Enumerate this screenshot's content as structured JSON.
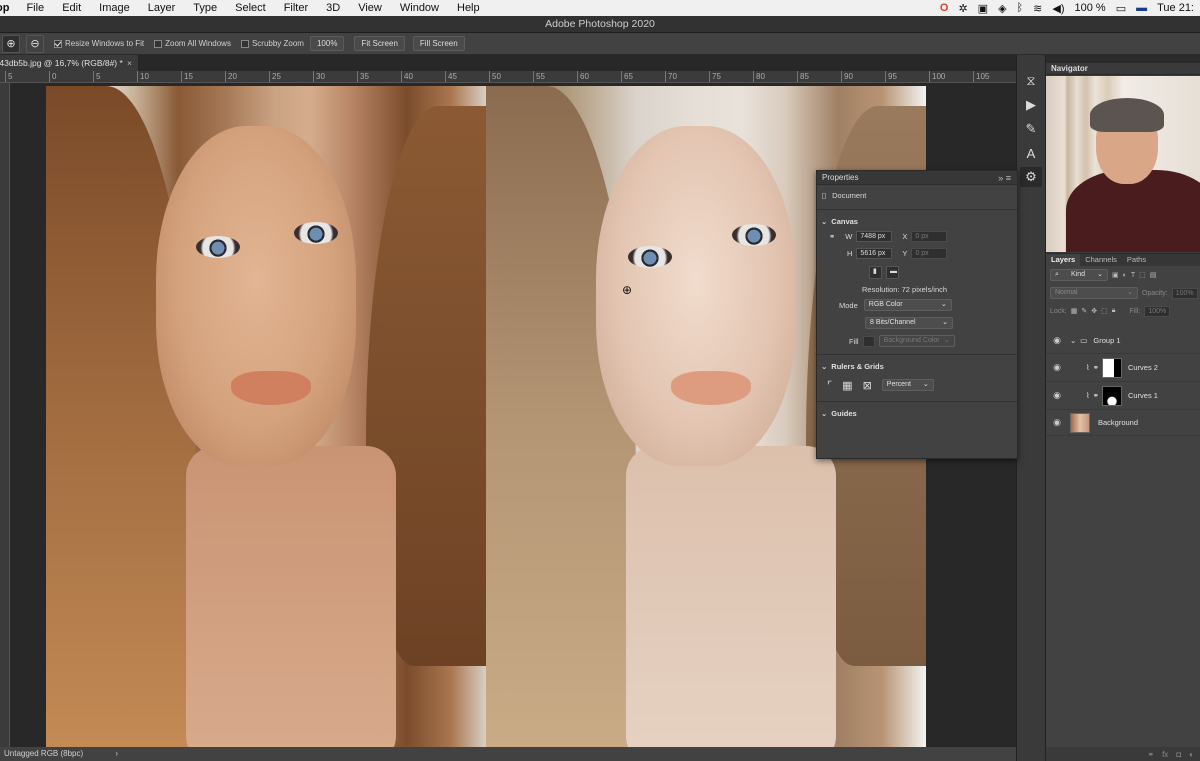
{
  "menubar": {
    "app": "op",
    "items": [
      "File",
      "Edit",
      "Image",
      "Layer",
      "Type",
      "Select",
      "Filter",
      "3D",
      "View",
      "Window",
      "Help"
    ],
    "battery": "100 %",
    "clock": "Tue 21:"
  },
  "titlebar": {
    "title": "Adobe Photoshop 2020"
  },
  "options": {
    "resize_windows": "Resize Windows to Fit",
    "zoom_all": "Zoom All Windows",
    "scrubby": "Scrubby Zoom",
    "zoom_pct": "100%",
    "fit_screen": "Fit Screen",
    "fill_screen": "Fill Screen"
  },
  "doctab": {
    "label": "f43db5b.jpg @ 16,7% (RGB/8#) *"
  },
  "ruler": {
    "ticks": [
      "5",
      "0",
      "5",
      "10",
      "15",
      "20",
      "25",
      "30",
      "35",
      "40",
      "45",
      "50",
      "55",
      "60",
      "65",
      "70",
      "75",
      "80",
      "85",
      "90",
      "95",
      "100",
      "105"
    ]
  },
  "status": {
    "text": "Untagged RGB (8bpc)"
  },
  "properties": {
    "title": "Properties",
    "doc": "Document",
    "canvas": "Canvas",
    "w_label": "W",
    "w_val": "7488 px",
    "h_label": "H",
    "h_val": "5616 px",
    "x_label": "X",
    "y_label": "Y",
    "x_val": "0 px",
    "y_val": "0 px",
    "resolution": "Resolution: 72 pixels/inch",
    "mode_label": "Mode",
    "mode_val": "RGB Color",
    "bits_val": "8 Bits/Channel",
    "fill_label": "Fill",
    "fill_val": "Background Color",
    "rulers": "Rulers & Grids",
    "units": "Percent",
    "guides": "Guides"
  },
  "navigator": {
    "title": "Navigator"
  },
  "layers": {
    "tabs": [
      "Layers",
      "Channels",
      "Paths"
    ],
    "kind": "Kind",
    "blend": "Normal",
    "opacity_label": "Opacity:",
    "opacity": "100%",
    "lock_label": "Lock:",
    "fill_label": "Fill:",
    "fill": "100%",
    "items": [
      {
        "name": "Group 1"
      },
      {
        "name": "Curves 2"
      },
      {
        "name": "Curves 1"
      },
      {
        "name": "Background"
      }
    ]
  }
}
